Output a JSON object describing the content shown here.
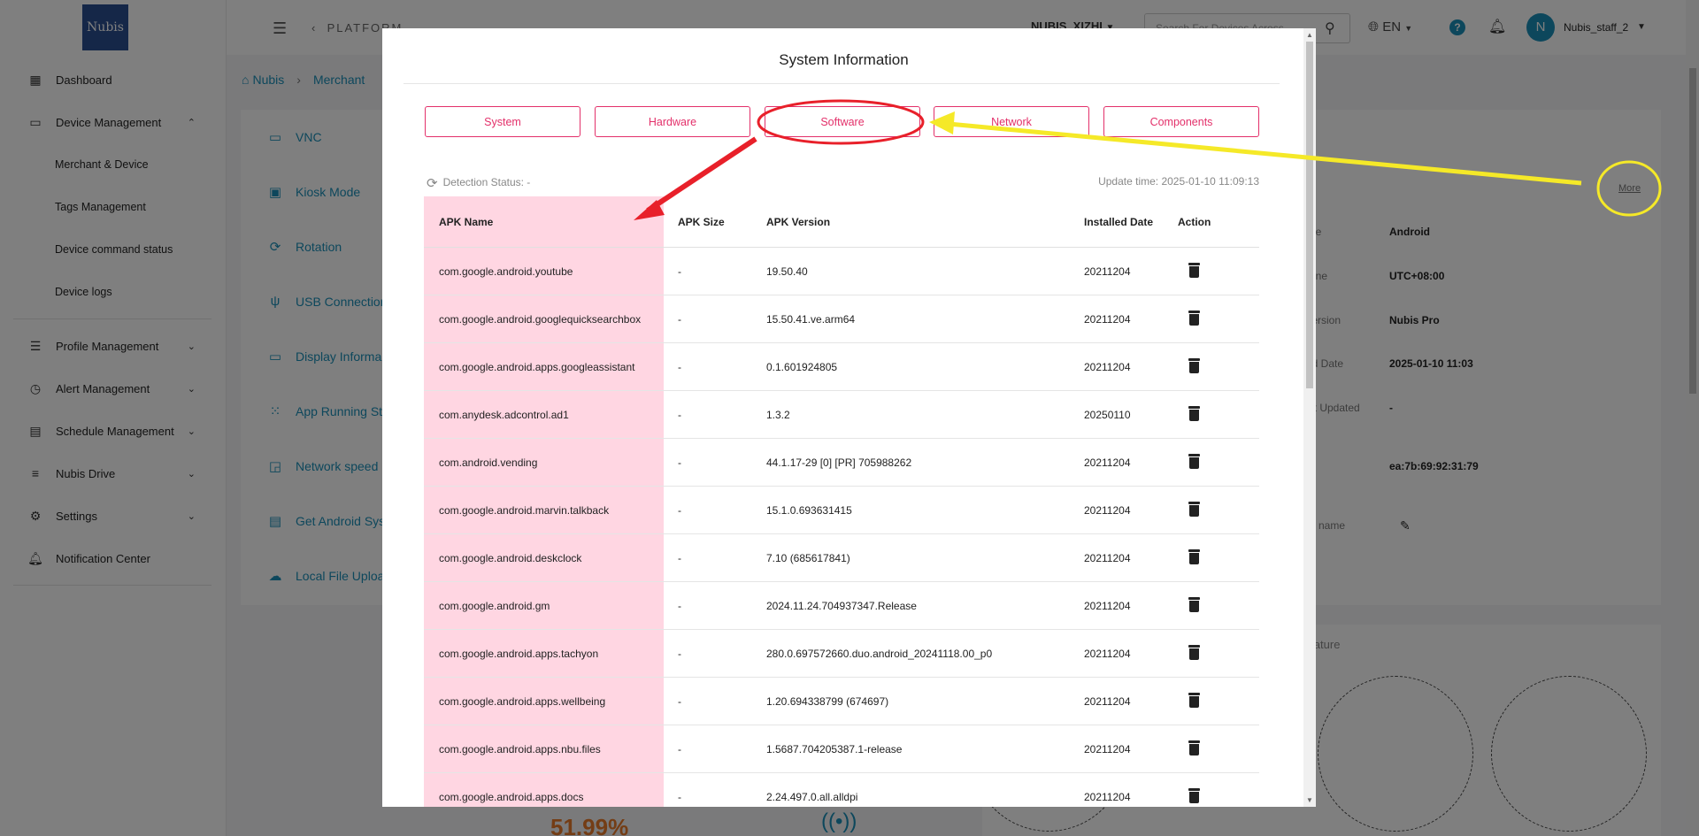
{
  "sidebar": {
    "logo": "Nubis",
    "items": [
      {
        "label": "Dashboard",
        "icon": "dashboard-icon"
      },
      {
        "label": "Device Management",
        "icon": "devices-icon",
        "expanded": true
      },
      {
        "label": "Merchant & Device"
      },
      {
        "label": "Tags Management"
      },
      {
        "label": "Device command status"
      },
      {
        "label": "Device logs"
      },
      {
        "label": "Profile Management",
        "icon": "profile-icon"
      },
      {
        "label": "Alert Management",
        "icon": "alarm-icon"
      },
      {
        "label": "Schedule Management",
        "icon": "calendar-icon"
      },
      {
        "label": "Nubis Drive",
        "icon": "list-icon"
      },
      {
        "label": "Settings",
        "icon": "settings-icon"
      },
      {
        "label": "Notification Center",
        "icon": "bell-icon"
      }
    ]
  },
  "topbar": {
    "platform": "PLATFORM",
    "org": "NUBIS_XIZHI",
    "search_placeholder": "Search For Devices Across",
    "lang": "EN",
    "avatar_letter": "N",
    "user": "Nubis_staff_2"
  },
  "background": {
    "breadcrumb": [
      "Nubis",
      "Merchant"
    ],
    "left_panel": [
      "VNC",
      "Kiosk Mode",
      "Rotation",
      "USB Connection",
      "Display Informa",
      "App Running St",
      "Network speed",
      "Get Android Sys",
      "Local File Uploa"
    ],
    "more": "More",
    "info": [
      {
        "label": "pe",
        "value": "Android"
      },
      {
        "label": "one",
        "value": "UTC+08:00"
      },
      {
        "label": "Version",
        "value": "Nubis Pro"
      },
      {
        "label": "ed Date",
        "value": "2025-01-10 11:03"
      },
      {
        "label": "ast Updated",
        "value": "-"
      },
      {
        "label": "",
        "value": "ea:7b:69:92:31:79"
      },
      {
        "label": "name",
        "value": ""
      }
    ],
    "temperature": "perature",
    "percent": "51.99%"
  },
  "modal": {
    "title": "System Information",
    "tabs": [
      "System",
      "Hardware",
      "Software",
      "Network",
      "Components"
    ],
    "detection_status": "Detection Status:  -",
    "update_time": "Update time: 2025-01-10 11:09:13",
    "columns": [
      "APK Name",
      "APK Size",
      "APK Version",
      "Installed Date",
      "Action"
    ],
    "rows": [
      {
        "name": "com.google.android.youtube",
        "size": "-",
        "version": "19.50.40",
        "date": "20211204"
      },
      {
        "name": "com.google.android.googlequicksearchbox",
        "size": "-",
        "version": "15.50.41.ve.arm64",
        "date": "20211204"
      },
      {
        "name": "com.google.android.apps.googleassistant",
        "size": "-",
        "version": "0.1.601924805",
        "date": "20211204"
      },
      {
        "name": "com.anydesk.adcontrol.ad1",
        "size": "-",
        "version": "1.3.2",
        "date": "20250110"
      },
      {
        "name": "com.android.vending",
        "size": "-",
        "version": "44.1.17-29 [0] [PR] 705988262",
        "date": "20211204"
      },
      {
        "name": "com.google.android.marvin.talkback",
        "size": "-",
        "version": "15.1.0.693631415",
        "date": "20211204"
      },
      {
        "name": "com.google.android.deskclock",
        "size": "-",
        "version": "7.10 (685617841)",
        "date": "20211204"
      },
      {
        "name": "com.google.android.gm",
        "size": "-",
        "version": "2024.11.24.704937347.Release",
        "date": "20211204"
      },
      {
        "name": "com.google.android.apps.tachyon",
        "size": "-",
        "version": "280.0.697572660.duo.android_20241118.00_p0",
        "date": "20211204"
      },
      {
        "name": "com.google.android.apps.wellbeing",
        "size": "-",
        "version": "1.20.694338799 (674697)",
        "date": "20211204"
      },
      {
        "name": "com.google.android.apps.nbu.files",
        "size": "-",
        "version": "1.5687.704205387.1-release",
        "date": "20211204"
      },
      {
        "name": "com.google.android.apps.docs",
        "size": "-",
        "version": "2.24.497.0.all.alldpi",
        "date": "20211204"
      }
    ]
  },
  "colors": {
    "accent": "#1a8fb8",
    "tab_border": "#e3306a",
    "apk_highlight": "#ffd6e2",
    "annotation_red": "#e8202a",
    "annotation_yellow": "#f5e928"
  }
}
